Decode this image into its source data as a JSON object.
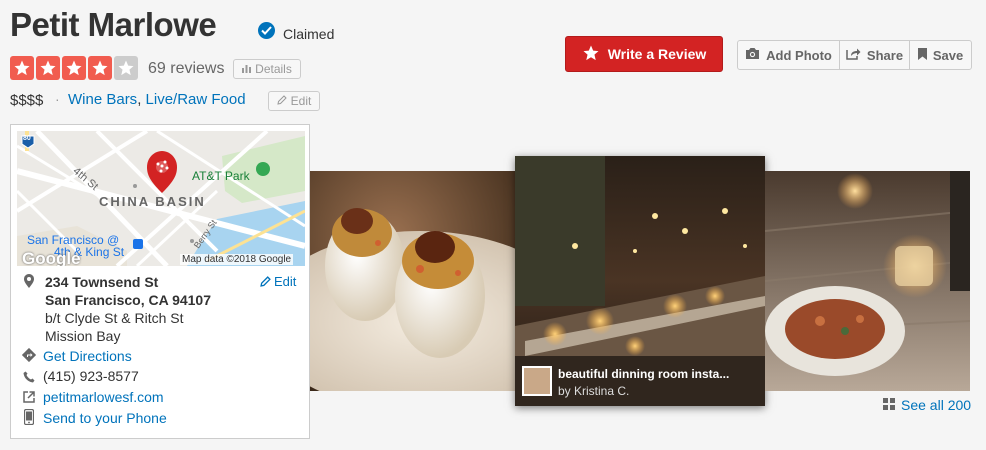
{
  "business": {
    "name": "Petit Marlowe",
    "claimed_label": "Claimed",
    "review_count": "69 reviews",
    "details_label": "Details",
    "rating": 4,
    "price": "$$$$",
    "separator": "·",
    "categories": [
      "Wine Bars",
      "Live/Raw Food"
    ],
    "category_sep": ",",
    "edit_label": "Edit"
  },
  "actions": {
    "write_review": "Write a Review",
    "add_photo": "Add Photo",
    "share": "Share",
    "save": "Save"
  },
  "map": {
    "labels": {
      "highway": "80",
      "street_4th": "4th St",
      "china_basin": "CHINA BASIN",
      "att_park": "AT&T Park",
      "station_1": "San Francisco @",
      "station_2": "4th & King St",
      "berry": "Berry St",
      "google": "Google",
      "attribution": "Map data ©2018 Google"
    }
  },
  "location": {
    "street": "234 Townsend St",
    "city": "San Francisco, CA 94107",
    "cross": "b/t Clyde St & Ritch St",
    "neighborhood": "Mission Bay",
    "edit_label": "Edit",
    "directions": "Get Directions",
    "phone": "(415) 923-8577",
    "website": "petitmarlowesf.com",
    "send_phone": "Send to your Phone"
  },
  "photos": {
    "caption_title": "beautiful dinning room insta...",
    "caption_by": "by Kristina C.",
    "see_all": "See all 200"
  },
  "colors": {
    "brand_red": "#d32323",
    "star_red": "#f15c4f",
    "link_blue": "#0073bb"
  }
}
